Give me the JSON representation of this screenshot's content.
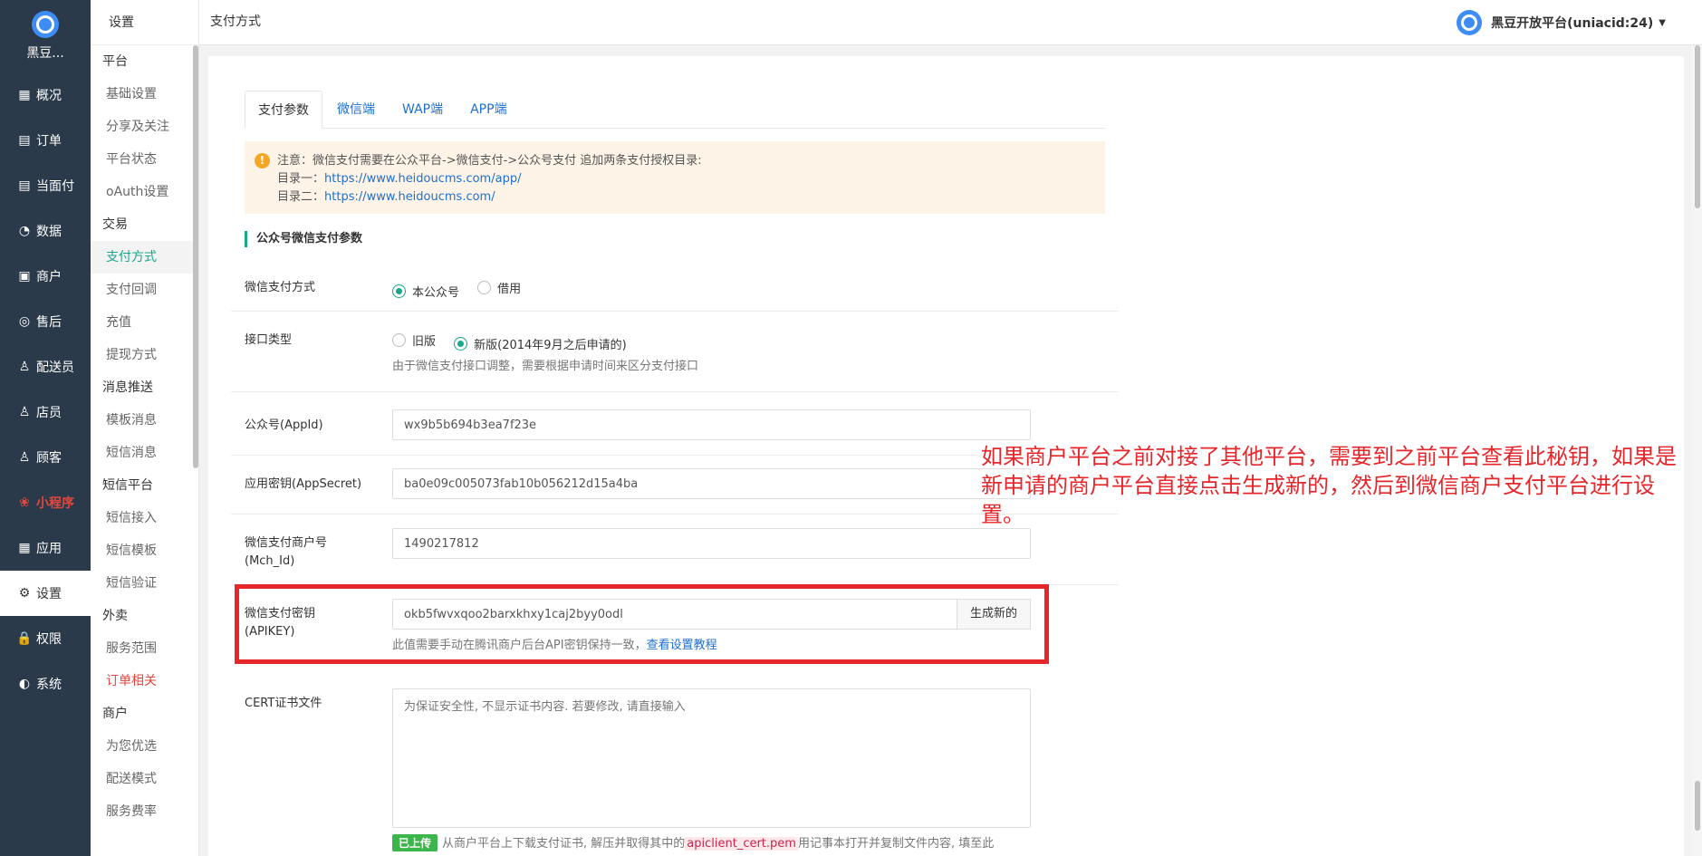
{
  "nav": {
    "brand": "黑豆...",
    "items": [
      {
        "label": "概况",
        "icon": "overview-icon",
        "glyph": "▦"
      },
      {
        "label": "订单",
        "icon": "order-icon",
        "glyph": "▤"
      },
      {
        "label": "当面付",
        "icon": "face-pay-icon",
        "glyph": "▤"
      },
      {
        "label": "数据",
        "icon": "data-icon",
        "glyph": "◔"
      },
      {
        "label": "商户",
        "icon": "shop-icon",
        "glyph": "▣"
      },
      {
        "label": "售后",
        "icon": "aftersale-icon",
        "glyph": "◎"
      },
      {
        "label": "配送员",
        "icon": "courier-icon",
        "glyph": "♙"
      },
      {
        "label": "店员",
        "icon": "clerk-icon",
        "glyph": "♙"
      },
      {
        "label": "顾客",
        "icon": "customer-icon",
        "glyph": "♙"
      },
      {
        "label": "小程序",
        "icon": "miniprogram-icon",
        "glyph": "❀"
      },
      {
        "label": "应用",
        "icon": "apps-icon",
        "glyph": "▦"
      },
      {
        "label": "设置",
        "icon": "settings-icon",
        "glyph": "⚙"
      },
      {
        "label": "权限",
        "icon": "lock-icon",
        "glyph": "🔒"
      },
      {
        "label": "系统",
        "icon": "system-icon",
        "glyph": "◐"
      }
    ]
  },
  "submenu": {
    "title": "设置",
    "groups": [
      {
        "title": "平台",
        "items": [
          "基础设置",
          "分享及关注",
          "平台状态",
          "oAuth设置"
        ]
      },
      {
        "title": "交易",
        "items": [
          "支付方式",
          "支付回调",
          "充值",
          "提现方式"
        ]
      },
      {
        "title": "消息推送",
        "items": [
          "模板消息",
          "短信消息"
        ]
      },
      {
        "title": "短信平台",
        "items": [
          "短信接入",
          "短信模板",
          "短信验证"
        ]
      },
      {
        "title": "外卖",
        "items": [
          "服务范围",
          "订单相关"
        ]
      },
      {
        "title": "商户",
        "items": [
          "为您优选",
          "配送模式",
          "服务费率"
        ]
      }
    ]
  },
  "header": {
    "title": "支付方式",
    "account": "黑豆开放平台(uniacid:24)"
  },
  "tabs": [
    "支付参数",
    "微信端",
    "WAP端",
    "APP端"
  ],
  "notice": {
    "line1": "注意：微信支付需要在公众平台->微信支付->公众号支付 追加两条支付授权目录:",
    "dir1_label": "目录一：",
    "dir1_url": "https://www.heidoucms.com/app/",
    "dir2_label": "目录二：",
    "dir2_url": "https://www.heidoucms.com/"
  },
  "section_title": "公众号微信支付参数",
  "form": {
    "pay_mode": {
      "label": "微信支付方式",
      "options": [
        "本公众号",
        "借用"
      ],
      "selected": "本公众号"
    },
    "api_type": {
      "label": "接口类型",
      "options": [
        "旧版",
        "新版(2014年9月之后申请的)"
      ],
      "selected": "新版(2014年9月之后申请的)",
      "help": "由于微信支付接口调整，需要根据申请时间来区分支付接口"
    },
    "appid": {
      "label": "公众号(AppId)",
      "value": "wx9b5b694b3ea7f23e"
    },
    "appsecret": {
      "label": "应用密钥(AppSecret)",
      "value": "ba0e09c005073fab10b056212d15a4ba"
    },
    "mch_id": {
      "label_line1": "微信支付商户号",
      "label_line2": "(Mch_Id)",
      "value": "1490217812"
    },
    "apikey": {
      "label_line1": "微信支付密钥",
      "label_line2": "(APIKEY)",
      "value": "okb5fwvxqoo2barxkhxy1caj2byy0odl",
      "button": "生成新的",
      "help": "此值需要手动在腾讯商户后台API密钥保持一致，",
      "help_link": "查看设置教程"
    },
    "cert": {
      "label": "CERT证书文件",
      "placeholder": "为保证安全性, 不显示证书内容. 若要修改, 请直接输入",
      "badge": "已上传",
      "help_pre": "从商户平台上下载支付证书, 解压并取得其中的",
      "help_code": "apiclient_cert.pem",
      "help_post": "用记事本打开并复制文件内容, 填至此"
    }
  },
  "annotation": "如果商户平台之前对接了其他平台，需要到之前平台查看此秘钥，如果是新申请的商户平台直接点击生成新的，然后到微信商户支付平台进行设置。",
  "colors": {
    "accent": "#18a78b",
    "nav_bg": "#2b3a4a",
    "link": "#1f6fd1",
    "highlight": "#e5262b"
  }
}
